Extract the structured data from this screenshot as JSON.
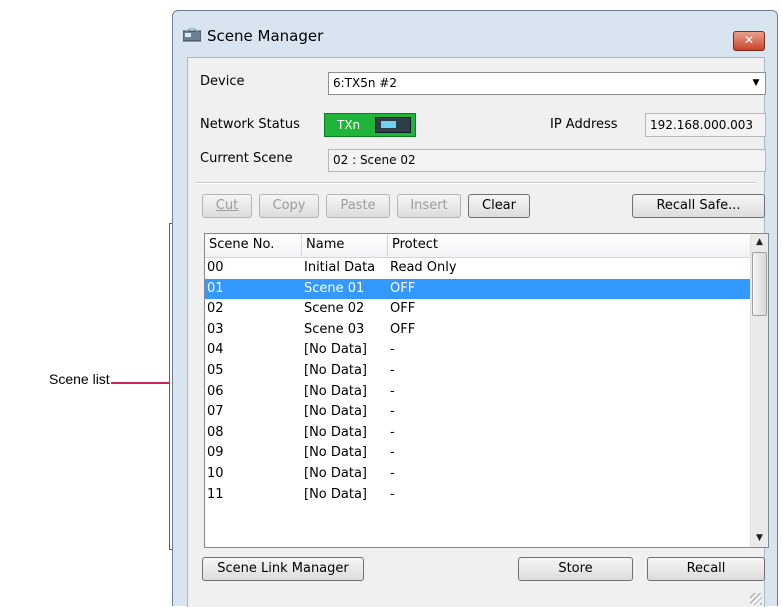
{
  "window": {
    "title": "Scene Manager",
    "close_symbol": "✕"
  },
  "device": {
    "label": "Device",
    "value": "6:TX5n #2"
  },
  "network": {
    "label": "Network Status",
    "badge_text": "TXn"
  },
  "ip": {
    "label": "IP Address",
    "value": "192.168.000.003"
  },
  "current_scene": {
    "label": "Current Scene",
    "value": "02 : Scene 02"
  },
  "toolbar": {
    "cut_label": "Cut",
    "copy_label": "Copy",
    "paste_label": "Paste",
    "insert_label": "Insert",
    "clear_label": "Clear",
    "recall_safe_label": "Recall Safe..."
  },
  "list": {
    "columns": [
      "Scene No.",
      "Name",
      "Protect"
    ],
    "rows": [
      {
        "no": "00",
        "name": "Initial Data",
        "protect": "Read Only"
      },
      {
        "no": "01",
        "name": "Scene 01",
        "protect": "OFF"
      },
      {
        "no": "02",
        "name": "Scene 02",
        "protect": "OFF"
      },
      {
        "no": "03",
        "name": "Scene 03",
        "protect": "OFF"
      },
      {
        "no": "04",
        "name": "[No Data]",
        "protect": "-"
      },
      {
        "no": "05",
        "name": "[No Data]",
        "protect": "-"
      },
      {
        "no": "06",
        "name": "[No Data]",
        "protect": "-"
      },
      {
        "no": "07",
        "name": "[No Data]",
        "protect": "-"
      },
      {
        "no": "08",
        "name": "[No Data]",
        "protect": "-"
      },
      {
        "no": "09",
        "name": "[No Data]",
        "protect": "-"
      },
      {
        "no": "10",
        "name": "[No Data]",
        "protect": "-"
      },
      {
        "no": "11",
        "name": "[No Data]",
        "protect": "-"
      }
    ],
    "selected_index": 1
  },
  "footer": {
    "scene_link_label": "Scene Link Manager",
    "store_label": "Store",
    "recall_label": "Recall"
  },
  "annotation": {
    "label": "Scene list"
  },
  "colors": {
    "selection": "#3399ff",
    "annotation": "#d0255c",
    "network_badge": "#1fb43a"
  }
}
